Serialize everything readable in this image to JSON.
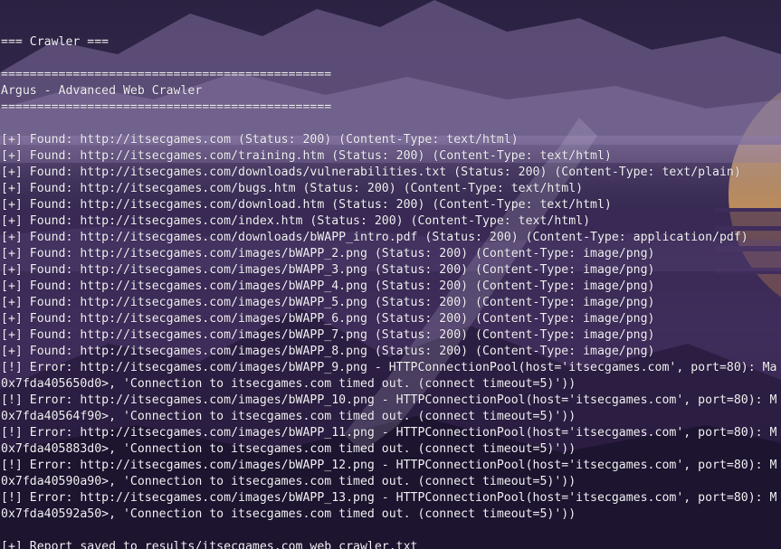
{
  "terminal": {
    "lines": [
      "",
      "=== Crawler ===",
      "",
      "==============================================",
      "Argus - Advanced Web Crawler",
      "==============================================",
      "",
      "[+] Found: http://itsecgames.com (Status: 200) (Content-Type: text/html)",
      "[+] Found: http://itsecgames.com/training.htm (Status: 200) (Content-Type: text/html)",
      "[+] Found: http://itsecgames.com/downloads/vulnerabilities.txt (Status: 200) (Content-Type: text/plain)",
      "[+] Found: http://itsecgames.com/bugs.htm (Status: 200) (Content-Type: text/html)",
      "[+] Found: http://itsecgames.com/download.htm (Status: 200) (Content-Type: text/html)",
      "[+] Found: http://itsecgames.com/index.htm (Status: 200) (Content-Type: text/html)",
      "[+] Found: http://itsecgames.com/downloads/bWAPP_intro.pdf (Status: 200) (Content-Type: application/pdf)",
      "[+] Found: http://itsecgames.com/images/bWAPP_2.png (Status: 200) (Content-Type: image/png)",
      "[+] Found: http://itsecgames.com/images/bWAPP_3.png (Status: 200) (Content-Type: image/png)",
      "[+] Found: http://itsecgames.com/images/bWAPP_4.png (Status: 200) (Content-Type: image/png)",
      "[+] Found: http://itsecgames.com/images/bWAPP_5.png (Status: 200) (Content-Type: image/png)",
      "[+] Found: http://itsecgames.com/images/bWAPP_6.png (Status: 200) (Content-Type: image/png)",
      "[+] Found: http://itsecgames.com/images/bWAPP_7.png (Status: 200) (Content-Type: image/png)",
      "[+] Found: http://itsecgames.com/images/bWAPP_8.png (Status: 200) (Content-Type: image/png)",
      "[!] Error: http://itsecgames.com/images/bWAPP_9.png - HTTPConnectionPool(host='itsecgames.com', port=80): Ma",
      "0x7fda405650d0>, 'Connection to itsecgames.com timed out. (connect timeout=5)'))",
      "[!] Error: http://itsecgames.com/images/bWAPP_10.png - HTTPConnectionPool(host='itsecgames.com', port=80): M",
      "0x7fda40564f90>, 'Connection to itsecgames.com timed out. (connect timeout=5)'))",
      "[!] Error: http://itsecgames.com/images/bWAPP_11.png - HTTPConnectionPool(host='itsecgames.com', port=80): M",
      "0x7fda405883d0>, 'Connection to itsecgames.com timed out. (connect timeout=5)'))",
      "[!] Error: http://itsecgames.com/images/bWAPP_12.png - HTTPConnectionPool(host='itsecgames.com', port=80): M",
      "0x7fda40590a90>, 'Connection to itsecgames.com timed out. (connect timeout=5)'))",
      "[!] Error: http://itsecgames.com/images/bWAPP_13.png - HTTPConnectionPool(host='itsecgames.com', port=80): M",
      "0x7fda40592a50>, 'Connection to itsecgames.com timed out. (connect timeout=5)'))",
      "",
      "[+] Report saved to results/itsecgames.com_web_crawler.txt"
    ]
  },
  "theme": {
    "text_color": "#f3f1f6",
    "sky_top": "#2a2140",
    "mountain_color": "#6a5a86",
    "sun_color": "#f4c56a",
    "water_color": "#3a2a55"
  },
  "icons": {
    "wallpaper": "mountain-lake-sunset-wallpaper",
    "watermark": "dragon-watermark-icon"
  }
}
